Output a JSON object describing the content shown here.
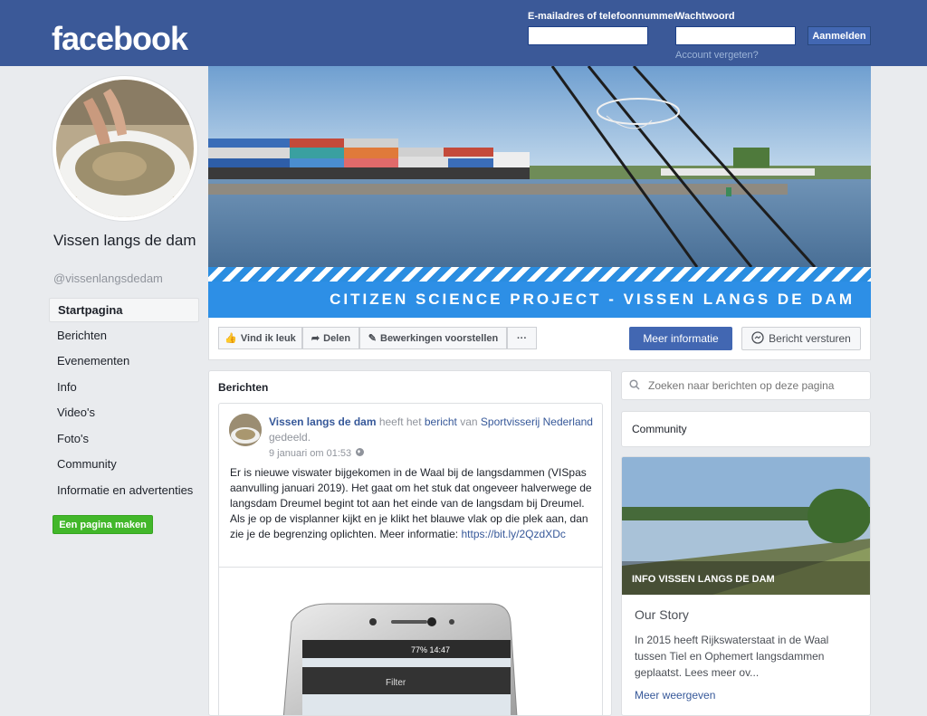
{
  "header": {
    "logo": "facebook",
    "email_label": "E-mailadres of telefoonnummer",
    "password_label": "Wachtwoord",
    "login_button": "Aanmelden",
    "forgot_link": "Account vergeten?"
  },
  "page": {
    "name": "Vissen langs de dam",
    "handle": "@vissenlangsdedam"
  },
  "sidebar": {
    "items": [
      {
        "label": "Startpagina",
        "active": true
      },
      {
        "label": "Berichten"
      },
      {
        "label": "Evenementen"
      },
      {
        "label": "Info"
      },
      {
        "label": "Video's"
      },
      {
        "label": "Foto's"
      },
      {
        "label": "Community"
      },
      {
        "label": "Informatie en advertenties"
      }
    ],
    "create_page_button": "Een pagina maken"
  },
  "cover": {
    "banner_text": "CITIZEN SCIENCE PROJECT - VISSEN LANGS DE DAM"
  },
  "actions": {
    "like": "Vind ik leuk",
    "share": "Delen",
    "suggest_edits": "Bewerkingen voorstellen",
    "more": "···",
    "more_info": "Meer informatie",
    "send_message": "Bericht versturen"
  },
  "posts": {
    "title": "Berichten",
    "post": {
      "author": "Vissen langs de dam",
      "shared_text_1": " heeft het ",
      "shared_link": "bericht",
      "shared_text_2": " van ",
      "source_page": "Sportvisserij Nederland",
      "shared_text_3": " gedeeld.",
      "timestamp": "9 januari om 01:53",
      "body": "Er is nieuwe viswater bijgekomen in de Waal bij de langsdammen (VISpas aanvulling januari 2019). Het gaat om het stuk dat ongeveer halverwege de langsdam Dreumel begint tot aan het einde van de langsdam bij Dreumel. Als je op de visplanner kijkt en je klikt het blauwe vlak op die plek aan, dan zie je de begrenzing oplichten. Meer informatie: ",
      "body_link": "https://bit.ly/2QzdXDc",
      "phone_status": "77% 14:47",
      "phone_filter": "Filter"
    }
  },
  "right": {
    "search_placeholder": "Zoeken naar berichten op deze pagina",
    "community": "Community",
    "story_image_label": "INFO VISSEN LANGS DE DAM",
    "story_title": "Our Story",
    "story_text": "In 2015 heeft Rijkswaterstaat in de Waal tussen Tiel en Ophemert langsdammen geplaatst. Lees meer ov...",
    "story_more": "Meer weergeven"
  },
  "colors": {
    "brand_blue": "#3b5998",
    "button_blue": "#4267b2",
    "create_green": "#42b72a",
    "banner_blue": "#2d8fe6"
  }
}
